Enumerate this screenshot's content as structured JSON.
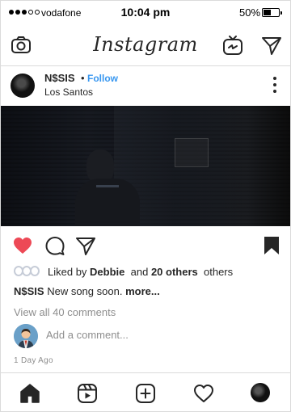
{
  "status_bar": {
    "carrier": "vodafone",
    "time": "10:04 pm",
    "battery": "50%",
    "battery_level": 0.5,
    "signal_bars_filled": 3,
    "signal_bars_total": 5
  },
  "header": {
    "logo": "Instagram",
    "icons": [
      "camera-icon",
      "igtv-icon",
      "direct-message-icon"
    ]
  },
  "post": {
    "username": "N$SIS",
    "separator": "•",
    "follow_label": "Follow",
    "location": "Los Santos",
    "likes": {
      "prefix": "Liked by",
      "first_liker": "Debbie",
      "and": "and",
      "others_count": "20 others",
      "suffix": "others"
    },
    "caption": {
      "username": "N$SIS",
      "text": "New song soon.",
      "more": "more..."
    },
    "view_comments": "View all 40 comments",
    "add_comment_placeholder": "Add a comment...",
    "timestamp": "1 Day Ago",
    "liked": true
  },
  "tab_bar": {
    "icons": [
      "home-icon",
      "reels-icon",
      "new-post-icon",
      "activity-icon",
      "profile-avatar"
    ]
  },
  "colors": {
    "accent_blue": "#3897f0",
    "like_red": "#ed4956",
    "text_primary": "#262626",
    "text_secondary": "#8e8e8e",
    "border": "#dbdbdb"
  }
}
